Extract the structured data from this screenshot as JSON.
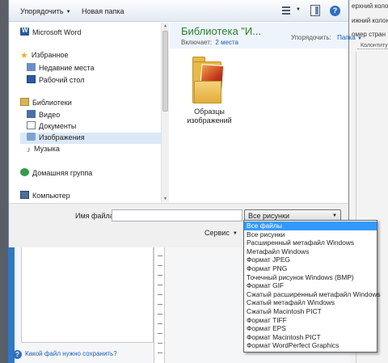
{
  "toolbar": {
    "organize_label": "Упорядочить",
    "new_folder_label": "Новая папка",
    "help_label": "?"
  },
  "nav": {
    "items": [
      {
        "label": "Microsoft Word",
        "icon": "word-icon"
      },
      {
        "label": "Избранное",
        "icon": "star-icon"
      },
      {
        "label": "Недавние места",
        "icon": "recent-places-icon"
      },
      {
        "label": "Рабочий стол",
        "icon": "desktop-icon"
      },
      {
        "label": "Библиотеки",
        "icon": "libraries-icon"
      },
      {
        "label": "Видео",
        "icon": "video-icon"
      },
      {
        "label": "Документы",
        "icon": "documents-icon"
      },
      {
        "label": "Изображения",
        "icon": "pictures-icon"
      },
      {
        "label": "Музыка",
        "icon": "music-icon"
      },
      {
        "label": "Домашняя группа",
        "icon": "homegroup-icon"
      },
      {
        "label": "Компьютер",
        "icon": "computer-icon"
      }
    ],
    "selected": "Изображения"
  },
  "library": {
    "title": "Библиотека \"И...",
    "includes_label": "Включает:",
    "includes_link": "2 места",
    "arrange_label": "Упорядочить:",
    "arrange_value": "Папка",
    "folder_label": "Образцы изображений"
  },
  "form": {
    "filename_label": "Имя файла:",
    "filename_value": "",
    "filetype_value": "Все рисунки",
    "service_label": "Сервис"
  },
  "filetype_options": [
    "Все файлы",
    "Все рисунки",
    "Расширенный метафайл Windows",
    "Метафайл Windows",
    "Формат JPEG",
    "Формат PNG",
    "Точечный рисунок Windows (BMP)",
    "Формат GIF",
    "Сжатый расширенный метафайл Windows",
    "Сжатый метафайл Windows",
    "Сжатый Macintosh PICT",
    "Формат TIFF",
    "Формат EPS",
    "Формат Macintosh PICT",
    "Формат WordPerfect Graphics"
  ],
  "filetype_highlighted": "Все файлы",
  "background_doc": {
    "lines": [
      "ерхний колон",
      "ижний колон",
      "омер стран"
    ],
    "ruler_label": "Колонтиту"
  },
  "background_help": {
    "help_link": "Какой файл нужно сохранить?"
  },
  "colors": {
    "selection": "#3399ff",
    "library_title": "#2d7d2d",
    "link": "#1a5fb4"
  }
}
